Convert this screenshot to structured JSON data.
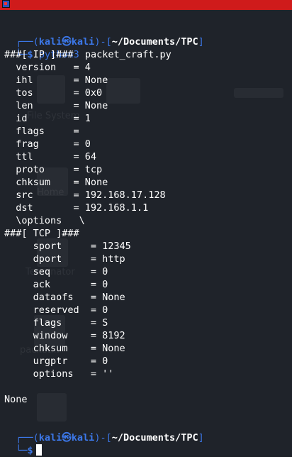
{
  "prompt": {
    "corner_top": "┌──(",
    "user": "kali",
    "at_symbol": "㉿",
    "host": "kali",
    "mid": ")-[",
    "path": "~/Documents/TPC",
    "end": "]",
    "corner_bottom": "└─",
    "dollar": "$"
  },
  "command": {
    "program": "python3",
    "argument": "packet_craft.py"
  },
  "output": {
    "lines": [
      "###[ IP ]###",
      "  version   = 4",
      "  ihl       = None",
      "  tos       = 0x0",
      "  len       = None",
      "  id        = 1",
      "  flags     =",
      "  frag      = 0",
      "  ttl       = 64",
      "  proto     = tcp",
      "  chksum    = None",
      "  src       = 192.168.17.128",
      "  dst       = 192.168.1.1",
      "  \\options   \\",
      "###[ TCP ]###",
      "     sport     = 12345",
      "     dport     = http",
      "     seq       = 0",
      "     ack       = 0",
      "     dataofs   = None",
      "     reserved  = 0",
      "     flags     = S",
      "     window    = 8192",
      "     chksum    = None",
      "     urgptr    = 0",
      "     options   = ''",
      "",
      "None"
    ]
  },
  "background_ghost": {
    "label_1": "File System",
    "label_2": "Home",
    "label_3": "Terminator",
    "label_4": "packet..."
  },
  "colors": {
    "titlebar": "#cf1b1b",
    "terminal_bg": "#1f232a",
    "prompt_blue": "#3c78ea",
    "text": "#ffffff"
  }
}
